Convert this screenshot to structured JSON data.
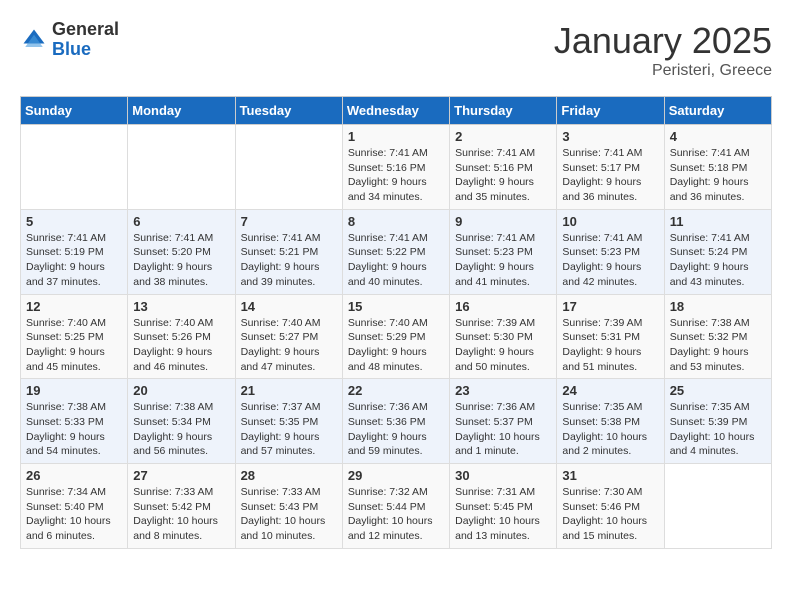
{
  "logo": {
    "general": "General",
    "blue": "Blue"
  },
  "title": "January 2025",
  "subtitle": "Peristeri, Greece",
  "headers": [
    "Sunday",
    "Monday",
    "Tuesday",
    "Wednesday",
    "Thursday",
    "Friday",
    "Saturday"
  ],
  "weeks": [
    [
      {
        "day": "",
        "lines": []
      },
      {
        "day": "",
        "lines": []
      },
      {
        "day": "",
        "lines": []
      },
      {
        "day": "1",
        "lines": [
          "Sunrise: 7:41 AM",
          "Sunset: 5:16 PM",
          "Daylight: 9 hours",
          "and 34 minutes."
        ]
      },
      {
        "day": "2",
        "lines": [
          "Sunrise: 7:41 AM",
          "Sunset: 5:16 PM",
          "Daylight: 9 hours",
          "and 35 minutes."
        ]
      },
      {
        "day": "3",
        "lines": [
          "Sunrise: 7:41 AM",
          "Sunset: 5:17 PM",
          "Daylight: 9 hours",
          "and 36 minutes."
        ]
      },
      {
        "day": "4",
        "lines": [
          "Sunrise: 7:41 AM",
          "Sunset: 5:18 PM",
          "Daylight: 9 hours",
          "and 36 minutes."
        ]
      }
    ],
    [
      {
        "day": "5",
        "lines": [
          "Sunrise: 7:41 AM",
          "Sunset: 5:19 PM",
          "Daylight: 9 hours",
          "and 37 minutes."
        ]
      },
      {
        "day": "6",
        "lines": [
          "Sunrise: 7:41 AM",
          "Sunset: 5:20 PM",
          "Daylight: 9 hours",
          "and 38 minutes."
        ]
      },
      {
        "day": "7",
        "lines": [
          "Sunrise: 7:41 AM",
          "Sunset: 5:21 PM",
          "Daylight: 9 hours",
          "and 39 minutes."
        ]
      },
      {
        "day": "8",
        "lines": [
          "Sunrise: 7:41 AM",
          "Sunset: 5:22 PM",
          "Daylight: 9 hours",
          "and 40 minutes."
        ]
      },
      {
        "day": "9",
        "lines": [
          "Sunrise: 7:41 AM",
          "Sunset: 5:23 PM",
          "Daylight: 9 hours",
          "and 41 minutes."
        ]
      },
      {
        "day": "10",
        "lines": [
          "Sunrise: 7:41 AM",
          "Sunset: 5:23 PM",
          "Daylight: 9 hours",
          "and 42 minutes."
        ]
      },
      {
        "day": "11",
        "lines": [
          "Sunrise: 7:41 AM",
          "Sunset: 5:24 PM",
          "Daylight: 9 hours",
          "and 43 minutes."
        ]
      }
    ],
    [
      {
        "day": "12",
        "lines": [
          "Sunrise: 7:40 AM",
          "Sunset: 5:25 PM",
          "Daylight: 9 hours",
          "and 45 minutes."
        ]
      },
      {
        "day": "13",
        "lines": [
          "Sunrise: 7:40 AM",
          "Sunset: 5:26 PM",
          "Daylight: 9 hours",
          "and 46 minutes."
        ]
      },
      {
        "day": "14",
        "lines": [
          "Sunrise: 7:40 AM",
          "Sunset: 5:27 PM",
          "Daylight: 9 hours",
          "and 47 minutes."
        ]
      },
      {
        "day": "15",
        "lines": [
          "Sunrise: 7:40 AM",
          "Sunset: 5:29 PM",
          "Daylight: 9 hours",
          "and 48 minutes."
        ]
      },
      {
        "day": "16",
        "lines": [
          "Sunrise: 7:39 AM",
          "Sunset: 5:30 PM",
          "Daylight: 9 hours",
          "and 50 minutes."
        ]
      },
      {
        "day": "17",
        "lines": [
          "Sunrise: 7:39 AM",
          "Sunset: 5:31 PM",
          "Daylight: 9 hours",
          "and 51 minutes."
        ]
      },
      {
        "day": "18",
        "lines": [
          "Sunrise: 7:38 AM",
          "Sunset: 5:32 PM",
          "Daylight: 9 hours",
          "and 53 minutes."
        ]
      }
    ],
    [
      {
        "day": "19",
        "lines": [
          "Sunrise: 7:38 AM",
          "Sunset: 5:33 PM",
          "Daylight: 9 hours",
          "and 54 minutes."
        ]
      },
      {
        "day": "20",
        "lines": [
          "Sunrise: 7:38 AM",
          "Sunset: 5:34 PM",
          "Daylight: 9 hours",
          "and 56 minutes."
        ]
      },
      {
        "day": "21",
        "lines": [
          "Sunrise: 7:37 AM",
          "Sunset: 5:35 PM",
          "Daylight: 9 hours",
          "and 57 minutes."
        ]
      },
      {
        "day": "22",
        "lines": [
          "Sunrise: 7:36 AM",
          "Sunset: 5:36 PM",
          "Daylight: 9 hours",
          "and 59 minutes."
        ]
      },
      {
        "day": "23",
        "lines": [
          "Sunrise: 7:36 AM",
          "Sunset: 5:37 PM",
          "Daylight: 10 hours",
          "and 1 minute."
        ]
      },
      {
        "day": "24",
        "lines": [
          "Sunrise: 7:35 AM",
          "Sunset: 5:38 PM",
          "Daylight: 10 hours",
          "and 2 minutes."
        ]
      },
      {
        "day": "25",
        "lines": [
          "Sunrise: 7:35 AM",
          "Sunset: 5:39 PM",
          "Daylight: 10 hours",
          "and 4 minutes."
        ]
      }
    ],
    [
      {
        "day": "26",
        "lines": [
          "Sunrise: 7:34 AM",
          "Sunset: 5:40 PM",
          "Daylight: 10 hours",
          "and 6 minutes."
        ]
      },
      {
        "day": "27",
        "lines": [
          "Sunrise: 7:33 AM",
          "Sunset: 5:42 PM",
          "Daylight: 10 hours",
          "and 8 minutes."
        ]
      },
      {
        "day": "28",
        "lines": [
          "Sunrise: 7:33 AM",
          "Sunset: 5:43 PM",
          "Daylight: 10 hours",
          "and 10 minutes."
        ]
      },
      {
        "day": "29",
        "lines": [
          "Sunrise: 7:32 AM",
          "Sunset: 5:44 PM",
          "Daylight: 10 hours",
          "and 12 minutes."
        ]
      },
      {
        "day": "30",
        "lines": [
          "Sunrise: 7:31 AM",
          "Sunset: 5:45 PM",
          "Daylight: 10 hours",
          "and 13 minutes."
        ]
      },
      {
        "day": "31",
        "lines": [
          "Sunrise: 7:30 AM",
          "Sunset: 5:46 PM",
          "Daylight: 10 hours",
          "and 15 minutes."
        ]
      },
      {
        "day": "",
        "lines": []
      }
    ]
  ]
}
